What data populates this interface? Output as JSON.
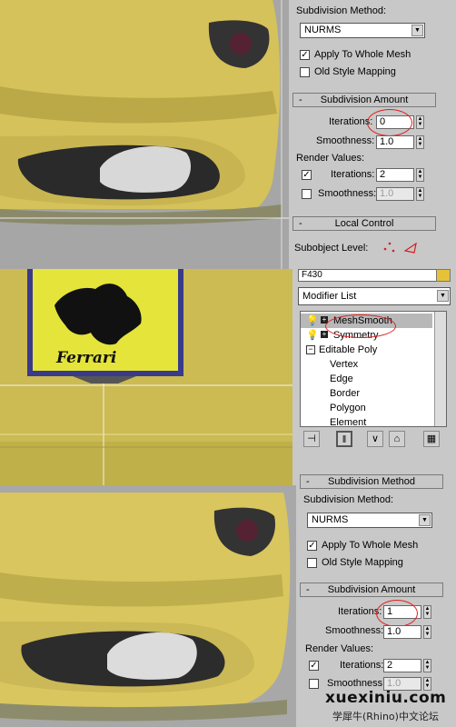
{
  "panel_top": {
    "subdiv_method_label": "Subdivision Method:",
    "method_value": "NURMS",
    "apply_whole_mesh": "Apply To Whole Mesh",
    "old_style_mapping": "Old Style Mapping",
    "subdiv_amount_head": "Subdivision Amount",
    "iterations_label": "Iterations:",
    "iterations_value": "0",
    "smoothness_label": "Smoothness:",
    "smoothness_value": "1.0",
    "render_values_label": "Render Values:",
    "render_iterations_label": "Iterations:",
    "render_iterations_value": "2",
    "render_smoothness_label": "Smoothness:",
    "render_smoothness_value": "1.0",
    "local_control_head": "Local Control",
    "subobject_level_label": "Subobject Level:"
  },
  "modifier_panel": {
    "object_name": "F430",
    "modifier_list": "Modifier List",
    "stack": [
      "MeshSmooth",
      "Symmetry",
      "Editable Poly",
      "Vertex",
      "Edge",
      "Border",
      "Polygon",
      "Element"
    ]
  },
  "logo": {
    "text": "Ferrari"
  },
  "panel_bottom": {
    "subdiv_method_head": "Subdivision Method",
    "subdiv_method_label": "Subdivision Method:",
    "method_value": "NURMS",
    "apply_whole_mesh": "Apply To Whole Mesh",
    "old_style_mapping": "Old Style Mapping",
    "subdiv_amount_head": "Subdivision Amount",
    "iterations_label": "Iterations:",
    "iterations_value": "1",
    "smoothness_label": "Smoothness:",
    "smoothness_value": "1.0",
    "render_values_label": "Render Values:",
    "render_iterations_label": "Iterations:",
    "render_iterations_value": "2",
    "render_smoothness_label": "Smoothness:",
    "render_smoothness_value": "1.0"
  },
  "watermark": {
    "site": "xuexiniu.com",
    "caption": "学犀牛(Rhino)中文论坛"
  },
  "colors": {
    "car_yellow": "#d8c45a",
    "viewport_gray": "#a8a8a8",
    "annotation_red": "#e02020",
    "logo_yellow": "#e6e63a"
  }
}
